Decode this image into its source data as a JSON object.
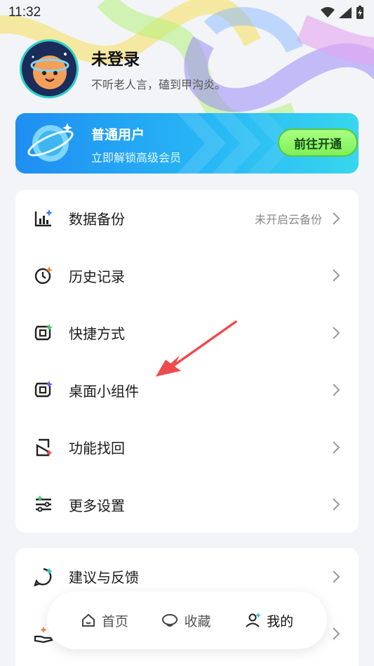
{
  "status_bar": {
    "time": "11:32"
  },
  "profile": {
    "name": "未登录",
    "motto": "不听老人言，磕到甲沟炎。"
  },
  "vip": {
    "title": "普通用户",
    "subtitle": "立即解锁高级会员",
    "button": "前往开通"
  },
  "menu_primary": [
    {
      "label": "数据备份",
      "right_text": "未开启云备份",
      "icon": "data-chart-icon"
    },
    {
      "label": "历史记录",
      "right_text": "",
      "icon": "history-clock-icon"
    },
    {
      "label": "快捷方式",
      "right_text": "",
      "icon": "shortcut-icon"
    },
    {
      "label": "桌面小组件",
      "right_text": "",
      "icon": "widget-icon"
    },
    {
      "label": "功能找回",
      "right_text": "",
      "icon": "restore-icon"
    },
    {
      "label": "更多设置",
      "right_text": "",
      "icon": "settings-sliders-icon"
    }
  ],
  "menu_secondary": [
    {
      "label": "建议与反馈",
      "icon": "feedback-bubble-icon"
    }
  ],
  "bottom_nav": [
    {
      "label": "首页",
      "icon": "home-icon"
    },
    {
      "label": "收藏",
      "icon": "favorite-icon"
    },
    {
      "label": "我的",
      "icon": "profile-icon",
      "active": true
    }
  ],
  "colors": {
    "accent_blue": "#1f8ef2",
    "vip_button": "#7fef5a",
    "annotation_arrow": "#ef4b4b"
  }
}
